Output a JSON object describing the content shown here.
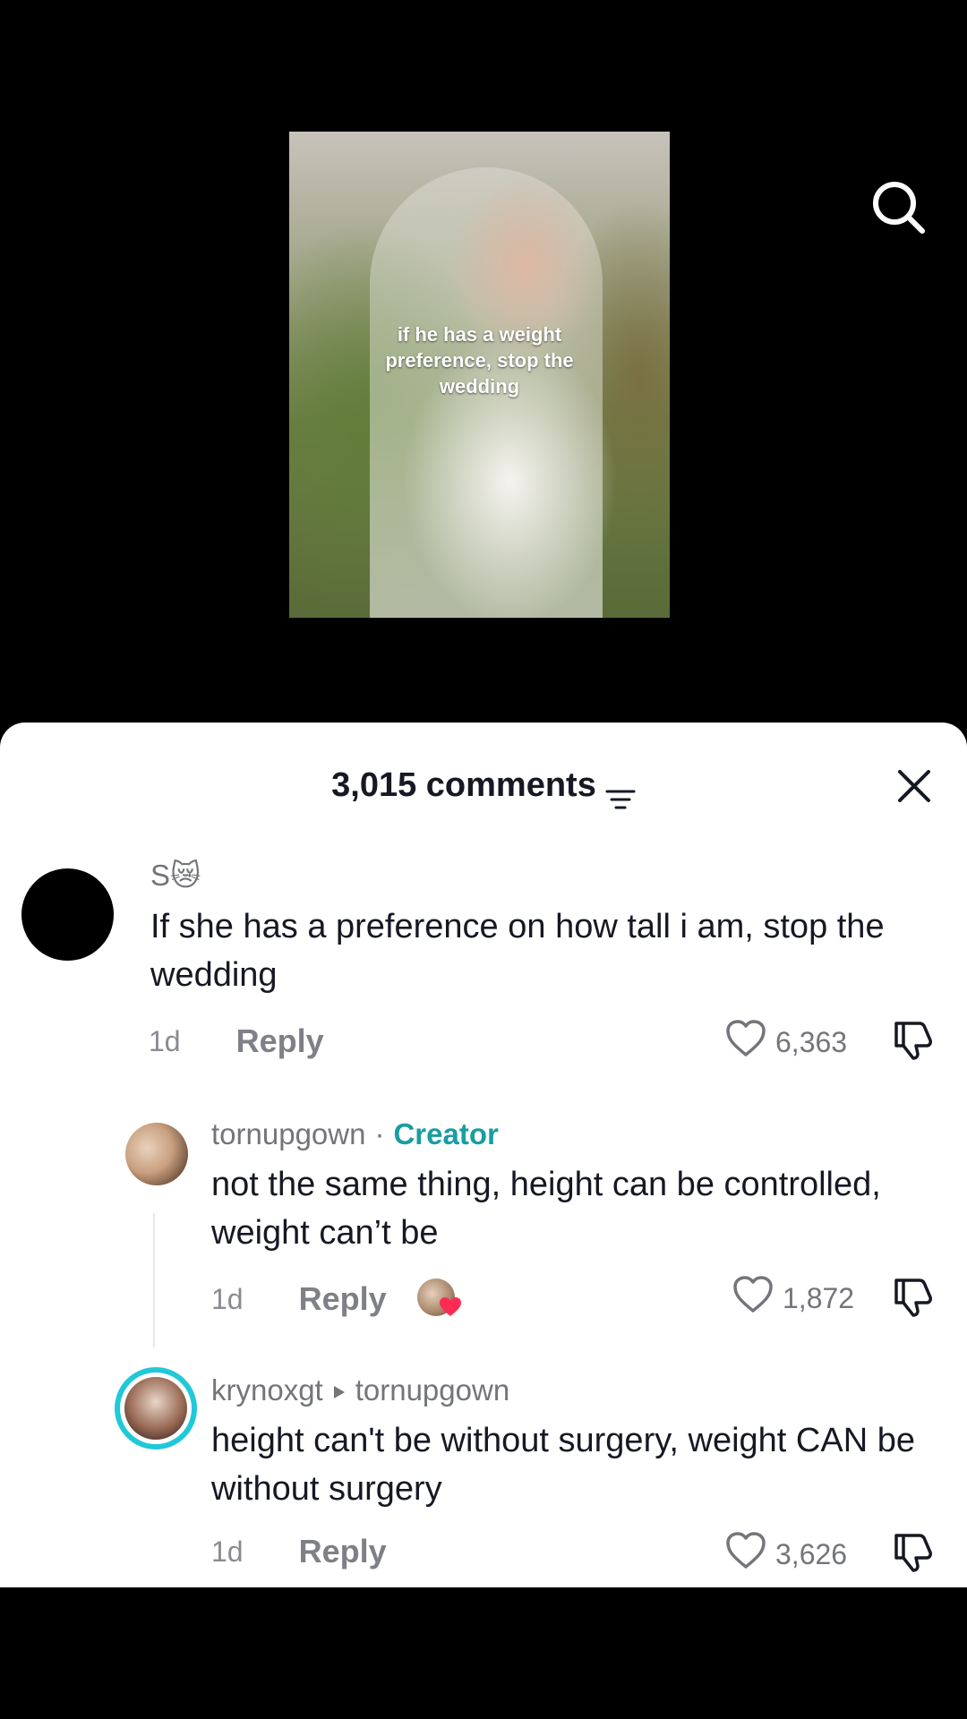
{
  "video": {
    "caption": "if he has a weight preference, stop the wedding"
  },
  "icons": {
    "search": "search-icon",
    "filter": "filter-icon",
    "close": "close-icon",
    "heart": "heart-icon",
    "dislike": "thumbs-down-icon",
    "reply_arrow": "triangle-right-icon"
  },
  "comments_panel": {
    "count_label": "3,015 comments"
  },
  "comments": [
    {
      "username": "S😿",
      "text": "If she has a preference on how tall i am, stop the wedding",
      "time": "1d",
      "reply_label": "Reply",
      "likes": "6,363"
    },
    {
      "username": "tornupgown",
      "separator": "·",
      "badge": "Creator",
      "text": "not the same thing, height can be controlled, weight can’t be",
      "time": "1d",
      "reply_label": "Reply",
      "likes": "1,872"
    },
    {
      "username": "krynoxgt",
      "reply_to": "tornupgown",
      "text": "height can't be without surgery, weight CAN be without surgery",
      "time": "1d",
      "reply_label": "Reply",
      "likes": "3,626"
    }
  ],
  "colors": {
    "creator_badge": "#1a9da0",
    "story_ring": "#20c8d8",
    "liked_heart": "#fe2c55"
  }
}
